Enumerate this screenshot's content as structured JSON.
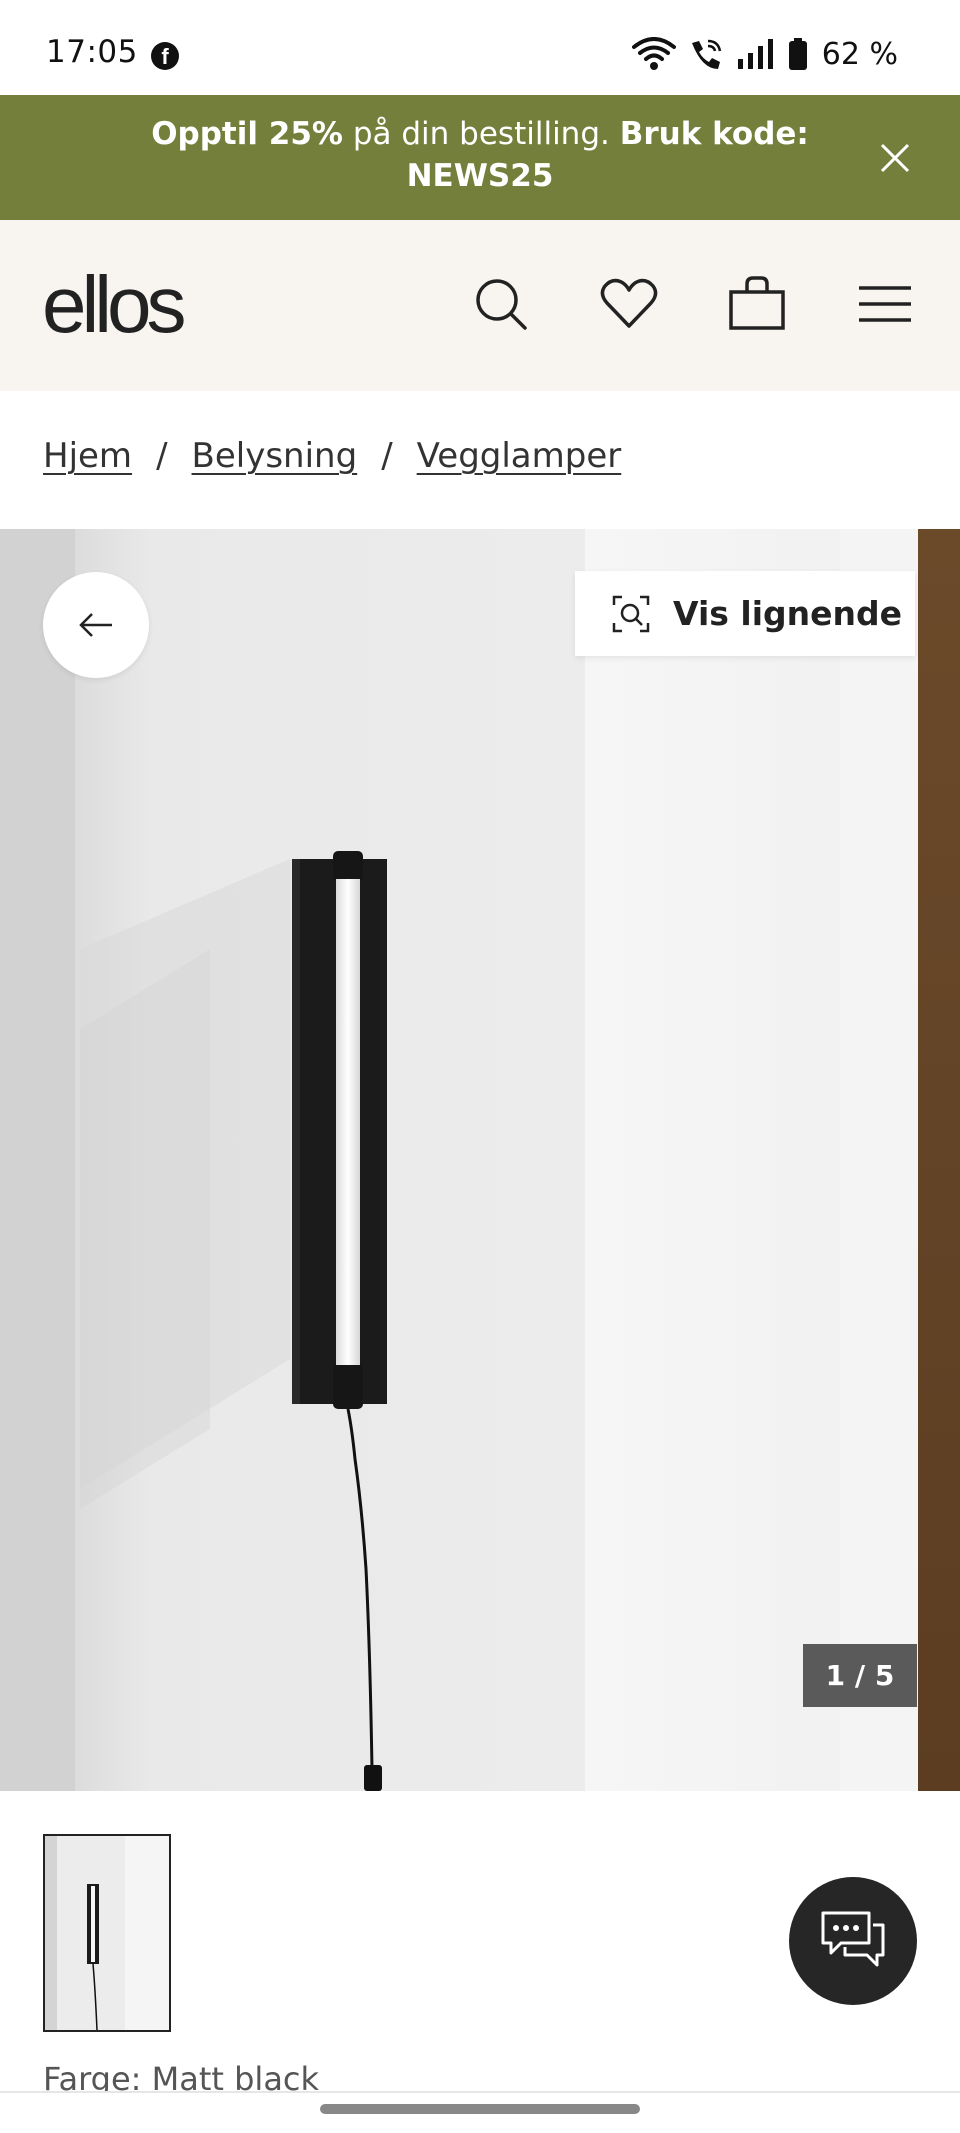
{
  "status_bar": {
    "time": "17:05",
    "app_icon": "facebook-icon",
    "battery": "62 %",
    "icons": [
      "wifi-icon",
      "wifi-call-icon",
      "signal-icon",
      "battery-icon"
    ]
  },
  "promo": {
    "bold_1": "Opptil 25%",
    "regular": " på din bestilling. ",
    "bold_2": "Bruk kode:",
    "code": "NEWS25",
    "close_icon": "close-icon",
    "background": "#737f3a"
  },
  "header": {
    "logo": "ellos",
    "icons": [
      "search-icon",
      "heart-icon",
      "bag-icon",
      "menu-icon"
    ],
    "background": "#f8f5f1"
  },
  "breadcrumb": {
    "items": [
      "Hjem",
      "Belysning",
      "Vegglamper"
    ],
    "separator": "/"
  },
  "gallery": {
    "back_icon": "arrow-left-icon",
    "similar_icon": "visual-search-icon",
    "similar_label": "Vis lignende",
    "counter": "1 / 5"
  },
  "chat": {
    "icon": "chat-icon",
    "color": "#262626"
  },
  "product": {
    "color_label": "Farge: Matt black"
  }
}
